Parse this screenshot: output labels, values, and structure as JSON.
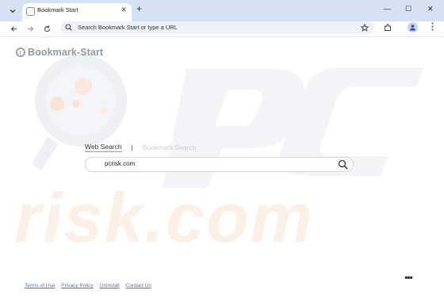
{
  "browser": {
    "tab_title": "Bookmark Start",
    "new_tab_glyph": "+",
    "omnibox_placeholder": "Search Bookmark Start or type a URL",
    "window_controls": {
      "minimize": "—",
      "maximize": "☐",
      "close": "✕"
    },
    "tab_close_glyph": "✕"
  },
  "page": {
    "logo_text": "Bookmark-Start",
    "tabs": {
      "web": "Web Search",
      "separator": "|",
      "bookmark": "Bookmark Search"
    },
    "search_value": "pcrisk.com",
    "footer_links": [
      "Terms of Use",
      "Privacy Policy",
      "Uninstall",
      "Contact Us"
    ],
    "more_glyph": "•••"
  },
  "colors": {
    "accent_underline": "#e28a4e",
    "footer_link": "#5b6cb7",
    "tabstrip": "#d6e1f4"
  }
}
